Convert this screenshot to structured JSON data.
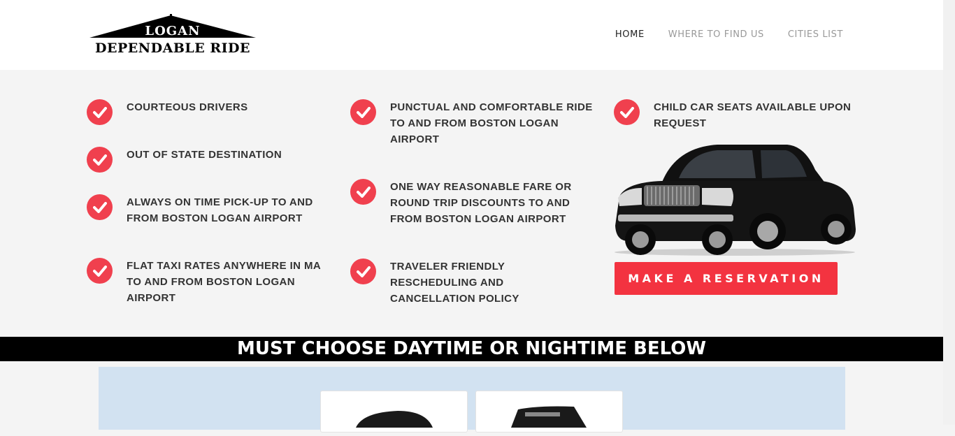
{
  "brand": {
    "logo_top": "LOGAN",
    "logo_bottom": "DEPENDABLE RIDE"
  },
  "nav": {
    "items": [
      {
        "label": "HOME",
        "active": true
      },
      {
        "label": "WHERE TO FIND US",
        "active": false
      },
      {
        "label": "CITIES LIST",
        "active": false
      }
    ]
  },
  "features": {
    "col1": [
      "COURTEOUS DRIVERS",
      "OUT OF STATE DESTINATION",
      "ALWAYS ON TIME PICK-UP TO AND FROM BOSTON LOGAN AIRPORT",
      "FLAT TAXI RATES ANYWHERE IN MA TO AND FROM BOSTON LOGAN AIRPORT"
    ],
    "col2": [
      "PUNCTUAL AND COMFORTABLE RIDE TO AND FROM BOSTON LOGAN AIRPORT",
      "ONE WAY REASONABLE FARE OR ROUND TRIP DISCOUNTS TO AND FROM BOSTON LOGAN AIRPORT",
      "TRAVELER FRIENDLY RESCHEDULING AND CANCELLATION POLICY"
    ],
    "col3": [
      "CHILD CAR SEATS AVAILABLE UPON REQUEST"
    ]
  },
  "reserve_label": "MAKE A RESERVATION",
  "banner_text": "MUST CHOOSE DAYTIME OR NIGHTIME BELOW",
  "colors": {
    "accent": "#f33340",
    "check": "#f0404e",
    "panel": "#d2e2f1",
    "banner_bg": "#000000"
  },
  "icons": {
    "feature": "check-circle-icon"
  }
}
